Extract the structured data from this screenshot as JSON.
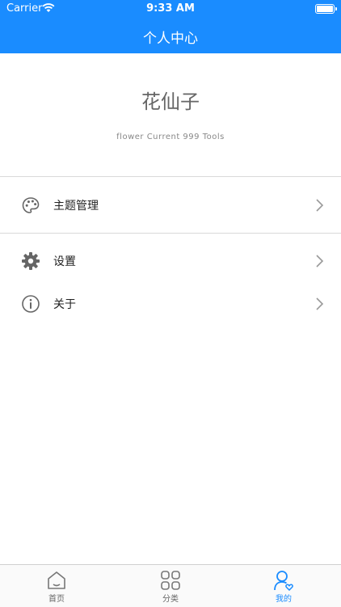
{
  "status": {
    "carrier": "Carrier",
    "time": "9:33 AM"
  },
  "nav": {
    "title": "个人中心"
  },
  "profile": {
    "name": "花仙子",
    "subtitle": "flower Current 999 Tools"
  },
  "menu": {
    "theme_label": "主题管理",
    "settings_label": "设置",
    "about_label": "关于"
  },
  "tabs": [
    {
      "label": "首页",
      "icon": "home-icon",
      "active": false
    },
    {
      "label": "分类",
      "icon": "grid-icon",
      "active": false
    },
    {
      "label": "我的",
      "icon": "user-heart-icon",
      "active": true
    }
  ],
  "colors": {
    "accent": "#1a8cff",
    "icon_gray": "#666666"
  }
}
